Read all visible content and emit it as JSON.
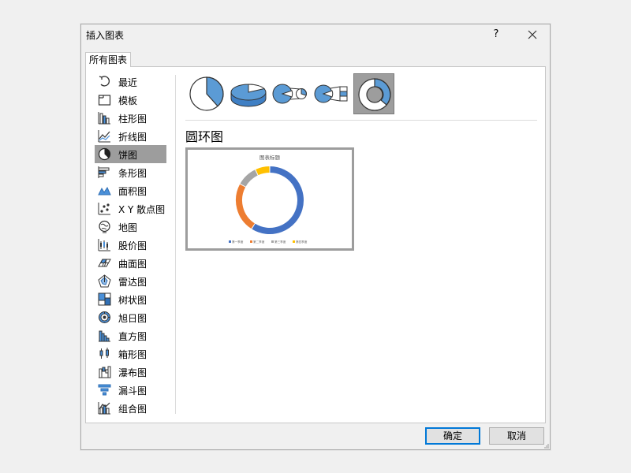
{
  "dialog": {
    "title": "插入图表",
    "help_label": "?",
    "close_label": "×"
  },
  "tabs": [
    {
      "label": "所有图表"
    }
  ],
  "sidebar": {
    "items": [
      {
        "label": "最近",
        "icon": "recent-icon"
      },
      {
        "label": "模板",
        "icon": "template-icon"
      },
      {
        "label": "柱形图",
        "icon": "column-chart-icon"
      },
      {
        "label": "折线图",
        "icon": "line-chart-icon"
      },
      {
        "label": "饼图",
        "icon": "pie-chart-icon",
        "selected": true
      },
      {
        "label": "条形图",
        "icon": "bar-chart-icon"
      },
      {
        "label": "面积图",
        "icon": "area-chart-icon"
      },
      {
        "label": "X Y 散点图",
        "icon": "scatter-chart-icon"
      },
      {
        "label": "地图",
        "icon": "map-chart-icon"
      },
      {
        "label": "股价图",
        "icon": "stock-chart-icon"
      },
      {
        "label": "曲面图",
        "icon": "surface-chart-icon"
      },
      {
        "label": "雷达图",
        "icon": "radar-chart-icon"
      },
      {
        "label": "树状图",
        "icon": "treemap-chart-icon"
      },
      {
        "label": "旭日图",
        "icon": "sunburst-chart-icon"
      },
      {
        "label": "直方图",
        "icon": "histogram-chart-icon"
      },
      {
        "label": "箱形图",
        "icon": "box-whisker-chart-icon"
      },
      {
        "label": "瀑布图",
        "icon": "waterfall-chart-icon"
      },
      {
        "label": "漏斗图",
        "icon": "funnel-chart-icon"
      },
      {
        "label": "组合图",
        "icon": "combo-chart-icon"
      }
    ]
  },
  "subtypes": [
    {
      "icon": "pie-icon"
    },
    {
      "icon": "3d-pie-icon"
    },
    {
      "icon": "pie-of-pie-icon"
    },
    {
      "icon": "bar-of-pie-icon"
    },
    {
      "icon": "doughnut-icon",
      "selected": true
    }
  ],
  "selected_subtype_title": "圆环图",
  "preview": {
    "title": "图表标题",
    "legend": [
      "第一季度",
      "第二季度",
      "第三季度",
      "第四季度"
    ]
  },
  "chart_data": {
    "type": "pie",
    "variant": "doughnut",
    "title": "图表标题",
    "categories": [
      "第一季度",
      "第二季度",
      "第三季度",
      "第四季度"
    ],
    "values": [
      59,
      24,
      10,
      7
    ],
    "colors": [
      "#4472c4",
      "#ed7d31",
      "#a5a5a5",
      "#ffc000"
    ],
    "legend_position": "bottom"
  },
  "footer": {
    "ok_label": "确定",
    "cancel_label": "取消"
  },
  "colors": {
    "accent": "#0078d7",
    "selection": "#9d9d9d",
    "icon_blue": "#4a90d9"
  }
}
